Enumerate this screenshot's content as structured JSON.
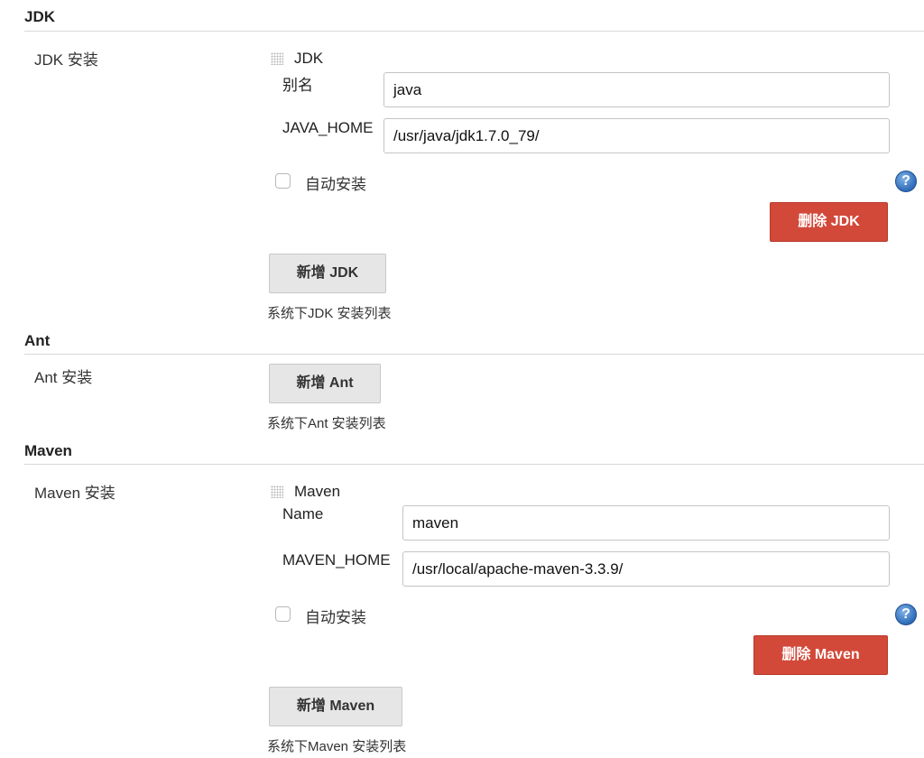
{
  "jdk": {
    "section_title": "JDK",
    "row_label": "JDK 安装",
    "item_name": "JDK",
    "alias_label": "别名",
    "alias_value": "java",
    "home_label": "JAVA_HOME",
    "home_value": "/usr/java/jdk1.7.0_79/",
    "auto_install_label": "自动安装",
    "help_icon": "?",
    "delete_button": "删除 JDK",
    "add_button": "新增 JDK",
    "description": "系统下JDK 安装列表"
  },
  "ant": {
    "section_title": "Ant",
    "row_label": "Ant 安装",
    "add_button": "新增 Ant",
    "description": "系统下Ant 安装列表"
  },
  "maven": {
    "section_title": "Maven",
    "row_label": "Maven 安装",
    "item_name": "Maven",
    "name_label": "Name",
    "name_value": "maven",
    "home_label": "MAVEN_HOME",
    "home_value": "/usr/local/apache-maven-3.3.9/",
    "auto_install_label": "自动安装",
    "help_icon": "?",
    "delete_button": "删除 Maven",
    "add_button": "新增 Maven",
    "description": "系统下Maven 安装列表"
  },
  "colors": {
    "delete_button_bg": "#d24939",
    "add_button_bg": "#e6e6e6",
    "help_icon": "#2e6cb8"
  },
  "icons": [
    "drag-handle-icon",
    "help-icon"
  ]
}
